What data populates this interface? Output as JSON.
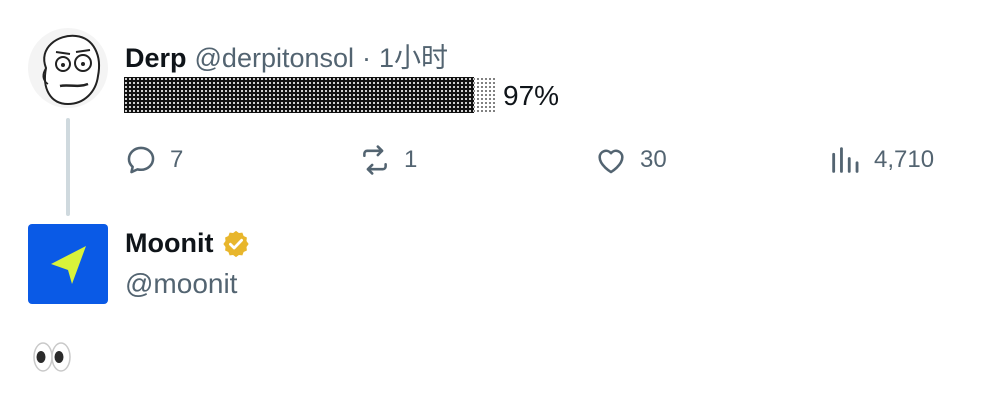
{
  "tweet1": {
    "display_name": "Derp",
    "handle": "@derpitonsol",
    "separator": "·",
    "time": "1小时",
    "progress": {
      "percent_label": "97%",
      "fill_fraction": 0.94
    },
    "actions": {
      "replies": "7",
      "reposts": "1",
      "likes": "30",
      "views": "4,710"
    }
  },
  "tweet2": {
    "display_name": "Moonit",
    "handle": "@moonit",
    "verified": true,
    "body_emoji_name": "eyes-emoji"
  },
  "colors": {
    "muted": "#536471",
    "verified_gold": "#e8b62c",
    "moonit_blue": "#0a5ae6",
    "moonit_arrow": "#d8f33a",
    "thread_line": "#cfd9de"
  }
}
